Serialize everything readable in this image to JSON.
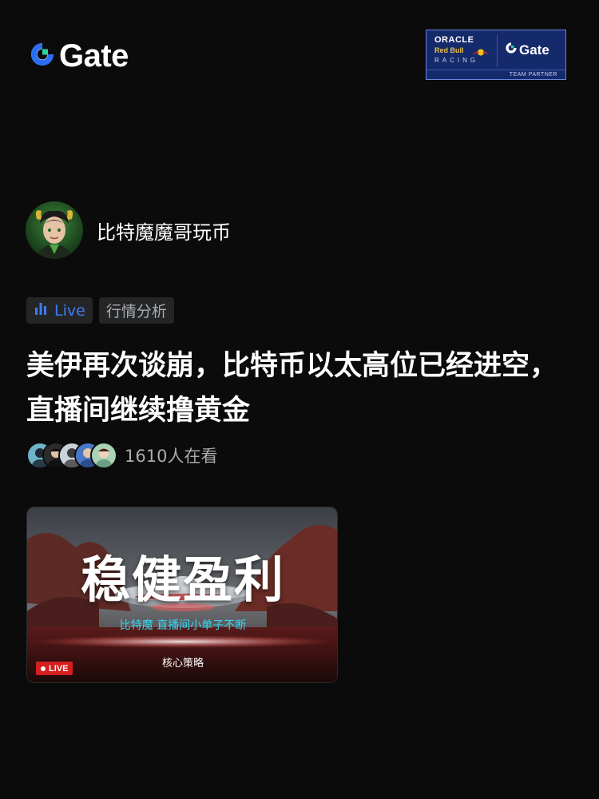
{
  "brand": {
    "logo_text": "Gate",
    "partner": {
      "oracle": "ORACLE",
      "red_bull": "Red Bull",
      "racing": "RACING",
      "gate_text": "Gate",
      "team_partner": "TEAM PARTNER"
    }
  },
  "author": {
    "name": "比特魔魔哥玩币",
    "avatar_icon": "avatar-icon"
  },
  "tags": {
    "live_label": "Live",
    "category": "行情分析"
  },
  "post": {
    "title": "美伊再次谈崩，比特币以太高位已经进空，直播间继续撸黄金"
  },
  "viewers": {
    "count_text": "1610人在看",
    "avatar_count": 5
  },
  "thumbnail": {
    "headline": "稳健盈利",
    "subtitle": "比特魔  直播间小单子不断",
    "strategy": "核心策略",
    "live_badge": "LIVE"
  },
  "colors": {
    "background": "#0b0b0c",
    "accent_blue": "#3d7df1",
    "live_red": "#d41f1f",
    "subtitle_cyan": "#37d5f0"
  }
}
